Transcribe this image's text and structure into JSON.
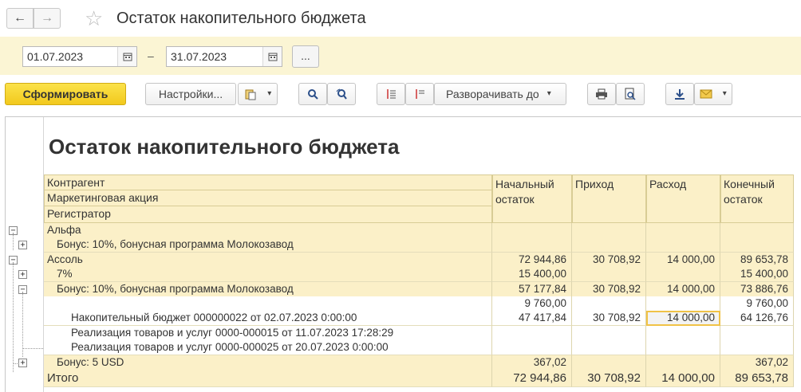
{
  "window": {
    "title": "Остаток накопительного бюджета",
    "back_icon": "←",
    "forward_icon": "→",
    "star_icon": "☆"
  },
  "period": {
    "date_from": "01.07.2023",
    "date_to": "31.07.2023",
    "dash": "–",
    "dots_label": "..."
  },
  "toolbar": {
    "generate_label": "Сформировать",
    "settings_label": "Настройки...",
    "expand_label": "Разворачивать до",
    "dropdown_arrow": "▾"
  },
  "report": {
    "title": "Остаток накопительного бюджета",
    "headers": {
      "group1": "Контрагент",
      "group2": "Маркетинговая акция",
      "group3": "Регистратор",
      "col_start": "Начальный остаток",
      "col_in": "Приход",
      "col_out": "Расход",
      "col_end": "Конечный остаток"
    },
    "rows": [
      {
        "label": "Альфа",
        "start": "",
        "in": "",
        "out": "",
        "end": ""
      },
      {
        "label": "Бонус: 10%, бонусная программа Молокозавод",
        "start": "",
        "in": "",
        "out": "",
        "end": ""
      },
      {
        "label": "Ассоль",
        "start": "72 944,86",
        "in": "30 708,92",
        "out": "14 000,00",
        "end": "89 653,78"
      },
      {
        "label": "7%",
        "start": "15 400,00",
        "in": "",
        "out": "",
        "end": "15 400,00"
      },
      {
        "label": "Бонус: 10%, бонусная программа Молокозавод",
        "start": "57 177,84",
        "in": "30 708,92",
        "out": "14 000,00",
        "end": "73 886,76"
      },
      {
        "label": "",
        "start": "9 760,00",
        "in": "",
        "out": "",
        "end": "9 760,00"
      },
      {
        "label": "Накопительный бюджет 000000022 от 02.07.2023 0:00:00",
        "start": "47 417,84",
        "in": "30 708,92",
        "out": "14 000,00",
        "end": "64 126,76"
      },
      {
        "label": "Реализация товаров и услуг 0000-000015 от 11.07.2023 17:28:29",
        "start": "",
        "in": "",
        "out": "",
        "end": ""
      },
      {
        "label": "Реализация товаров и услуг 0000-000025 от 20.07.2023 0:00:00",
        "start": "",
        "in": "",
        "out": "",
        "end": ""
      },
      {
        "label": "Бонус: 5 USD",
        "start": "367,02",
        "in": "",
        "out": "",
        "end": "367,02"
      }
    ],
    "total": {
      "label": "Итого",
      "start": "72 944,86",
      "in": "30 708,92",
      "out": "14 000,00",
      "end": "89 653,78"
    },
    "toggle_minus": "−",
    "toggle_plus": "+"
  }
}
